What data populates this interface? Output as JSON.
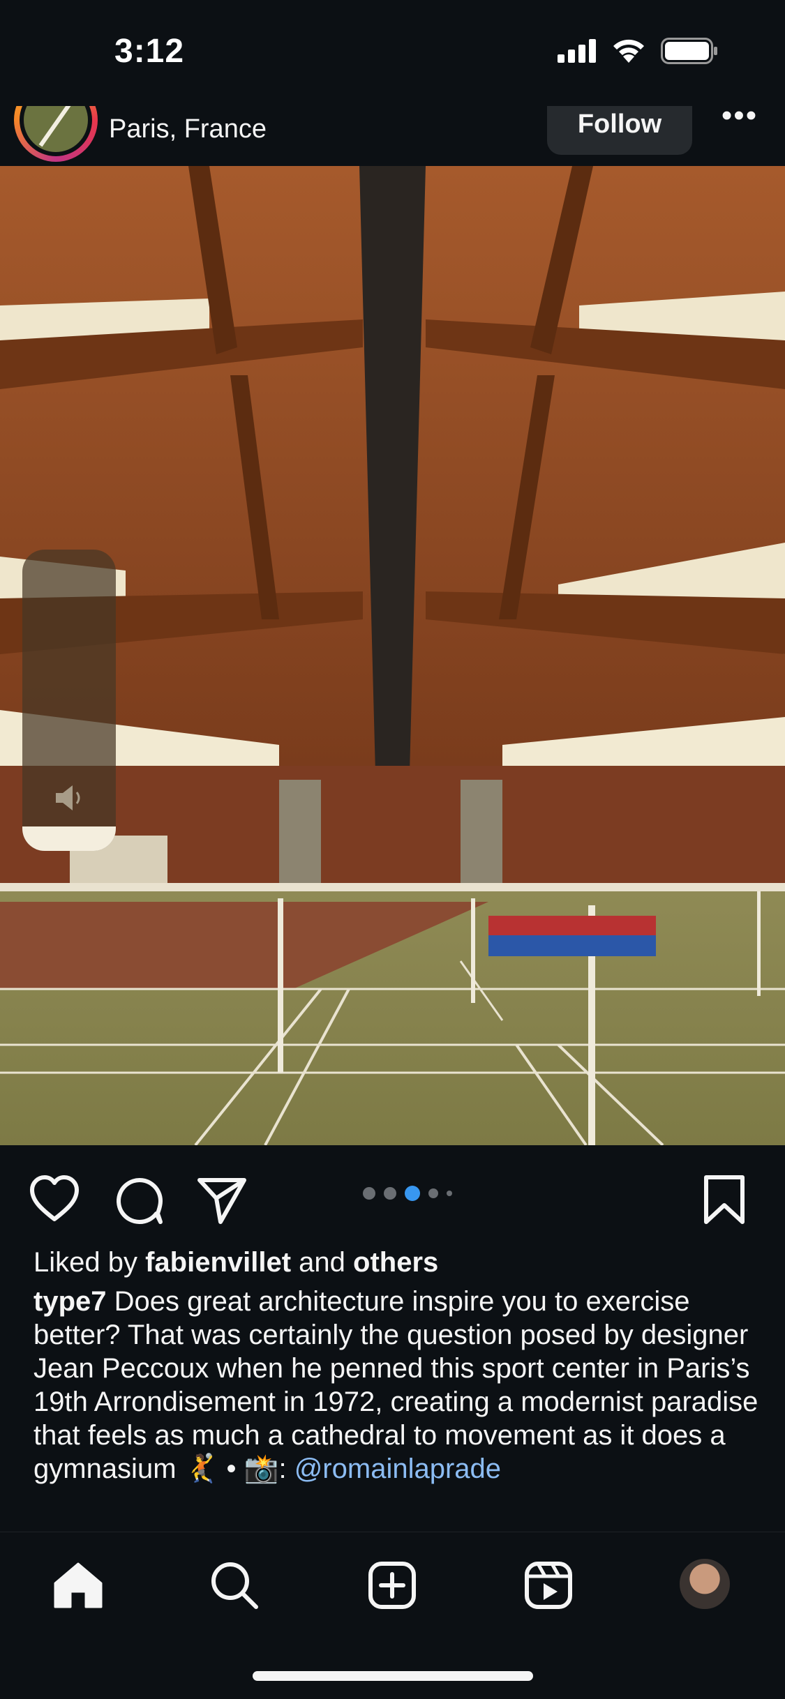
{
  "status_bar": {
    "time": "3:12",
    "icons": [
      "signal-icon",
      "wifi-icon",
      "battery-icon"
    ]
  },
  "post": {
    "location": "Paris, France",
    "follow_label": "Follow",
    "more_label": "•••",
    "carousel": {
      "count": 5,
      "active_index": 2
    },
    "volume_level": 0.08,
    "likes": {
      "prefix": "Liked by ",
      "user": "fabienvillet",
      "middle": " and ",
      "others": "others"
    },
    "caption": {
      "username": "type7",
      "text": " Does great architecture inspire you to exercise better? That was certainly the question posed by designer Jean Peccoux when he penned this sport center in Paris’s 19th Arrondisement in 1972, creating a modernist paradise that feels as much a cathedral to movement as it does a gymnasium 🤾 • 📸: ",
      "mention": "@romainlaprade"
    }
  },
  "nav": {
    "items": [
      "home-icon",
      "search-icon",
      "create-icon",
      "reels-icon",
      "profile-avatar"
    ]
  },
  "colors": {
    "background": "#0c1014",
    "text": "#f5f5f5",
    "mention": "#8cbcf3",
    "active_dot": "#3897f0",
    "follow_button": "#262a2e"
  }
}
